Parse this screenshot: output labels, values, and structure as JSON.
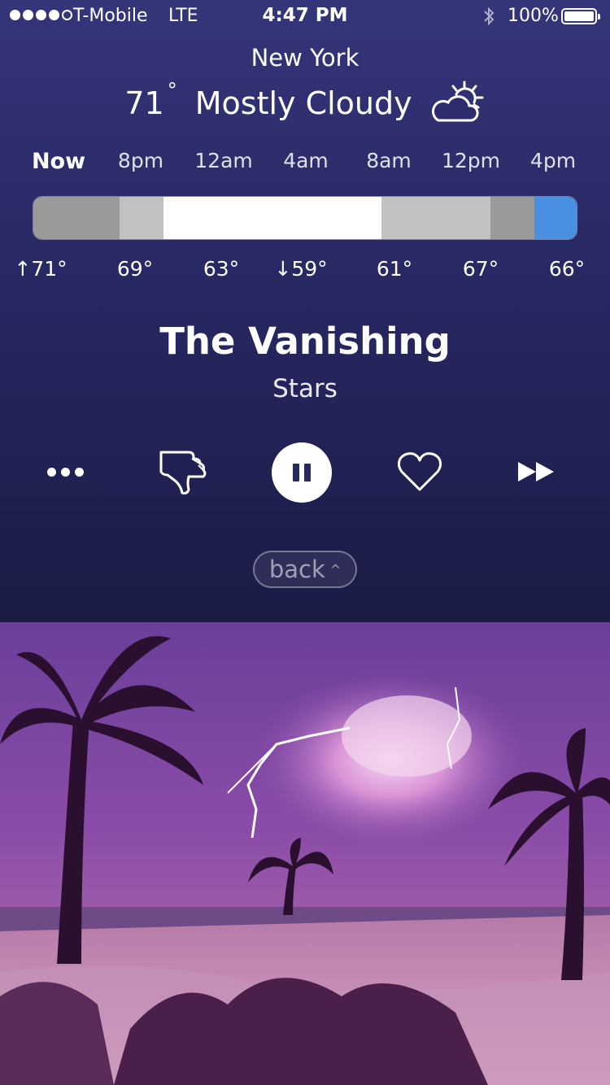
{
  "status_bar": {
    "carrier": "T-Mobile",
    "network": "LTE",
    "time": "4:47 PM",
    "battery": "100%"
  },
  "weather": {
    "city": "New York",
    "temperature": "71",
    "degree_symbol": "°",
    "condition": "Mostly Cloudy",
    "icon": "partly-cloudy-icon",
    "hours": [
      "Now",
      "8pm",
      "12am",
      "4am",
      "8am",
      "12pm",
      "4pm"
    ],
    "temps": [
      "↑71°",
      "69°",
      "63°",
      "↓59°",
      "61°",
      "67°",
      "66°"
    ],
    "bar_colors": [
      "#9a9a9a",
      "#c2c2c2",
      "#ffffff",
      "#c2c2c2",
      "#9a9a9a",
      "#4a90e2"
    ]
  },
  "player": {
    "track_title": "The Vanishing",
    "artist": "Stars",
    "back_label": "back",
    "back_chevron": "^"
  }
}
